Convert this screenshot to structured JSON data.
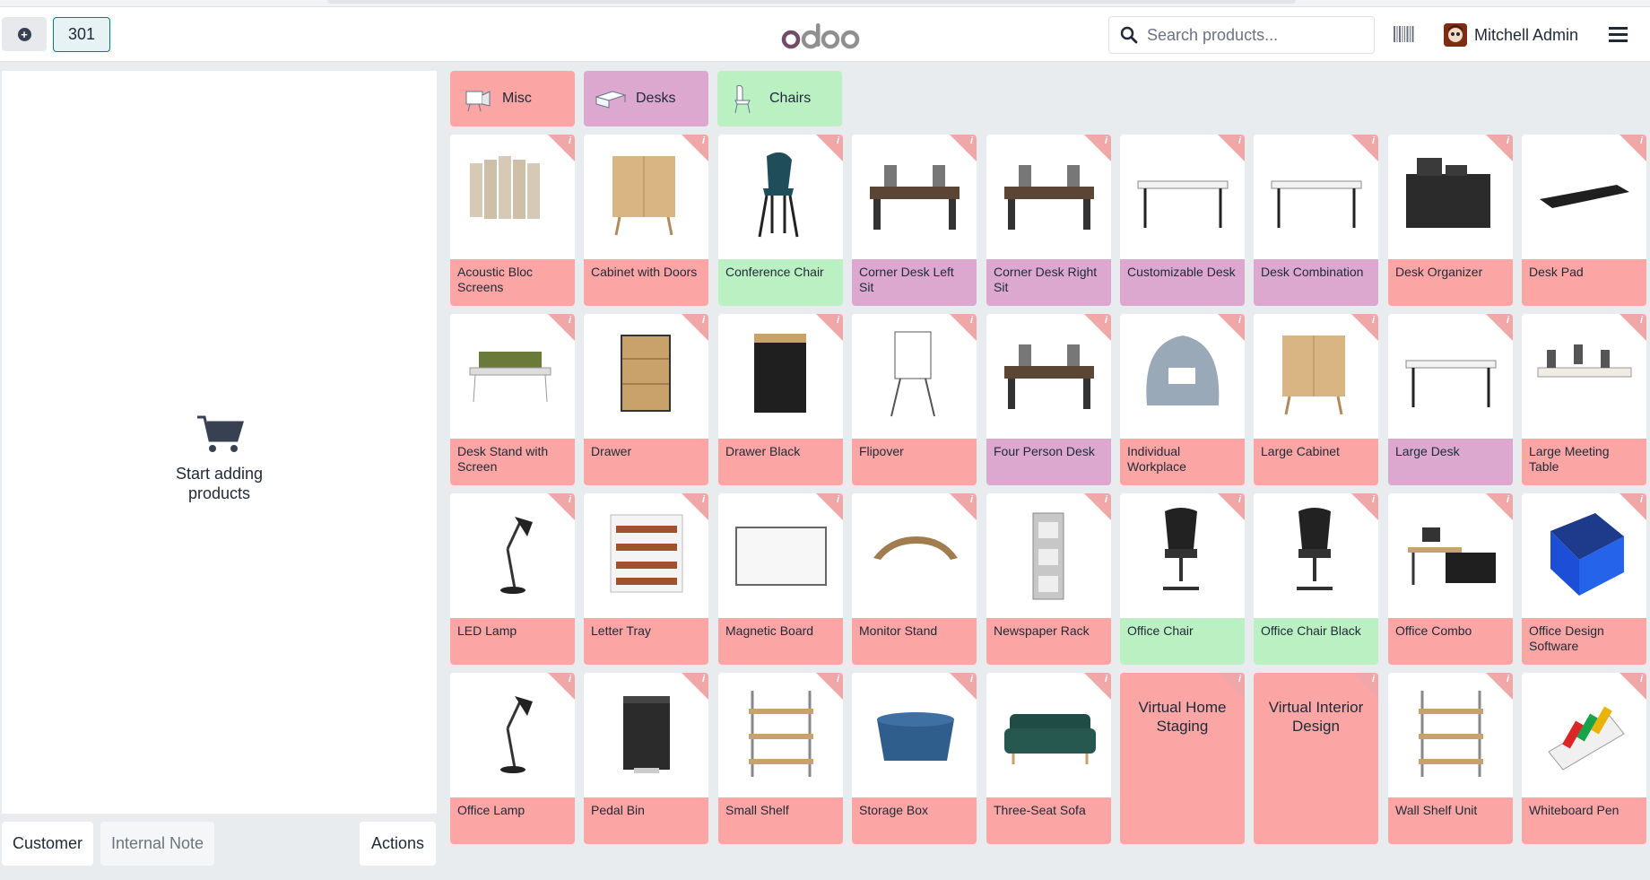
{
  "navbar": {
    "order_number": "301",
    "logo": "odoo",
    "search_placeholder": "Search products...",
    "user_name": "Mitchell Admin"
  },
  "cart": {
    "empty_text": "Start adding products"
  },
  "bottom_buttons": {
    "customer": "Customer",
    "internal_note": "Internal Note",
    "actions": "Actions"
  },
  "colors": {
    "misc": "#fca5a5",
    "desks": "#dca8d0",
    "chairs": "#bbf0c3",
    "accent": "#017e84"
  },
  "categories": [
    {
      "label": "Misc",
      "color": "#fca5a5",
      "icon": "misc-icon"
    },
    {
      "label": "Desks",
      "color": "#dca8d0",
      "icon": "desk-icon"
    },
    {
      "label": "Chairs",
      "color": "#bbf0c3",
      "icon": "chair-icon"
    }
  ],
  "products": [
    {
      "name": "Acoustic Bloc Screens",
      "category": "misc",
      "icon": "screen-icon"
    },
    {
      "name": "Cabinet with Doors",
      "category": "misc",
      "icon": "cabinet-icon"
    },
    {
      "name": "Conference Chair",
      "category": "chairs",
      "icon": "chair-icon"
    },
    {
      "name": "Corner Desk Left Sit",
      "category": "desks",
      "icon": "desk-icon"
    },
    {
      "name": "Corner Desk Right Sit",
      "category": "desks",
      "icon": "desk-icon"
    },
    {
      "name": "Customizable Desk",
      "category": "desks",
      "icon": "table-icon"
    },
    {
      "name": "Desk Combination",
      "category": "desks",
      "icon": "table-icon"
    },
    {
      "name": "Desk Organizer",
      "category": "misc",
      "icon": "organizer-icon"
    },
    {
      "name": "Desk Pad",
      "category": "misc",
      "icon": "pad-icon"
    },
    {
      "name": "Desk Stand with Screen",
      "category": "misc",
      "icon": "stand-icon"
    },
    {
      "name": "Drawer",
      "category": "misc",
      "icon": "drawer-icon"
    },
    {
      "name": "Drawer Black",
      "category": "misc",
      "icon": "drawer-black-icon"
    },
    {
      "name": "Flipover",
      "category": "misc",
      "icon": "flipover-icon"
    },
    {
      "name": "Four Person Desk",
      "category": "desks",
      "icon": "desk-icon"
    },
    {
      "name": "Individual Workplace",
      "category": "misc",
      "icon": "pod-icon"
    },
    {
      "name": "Large Cabinet",
      "category": "misc",
      "icon": "cabinet-icon"
    },
    {
      "name": "Large Desk",
      "category": "desks",
      "icon": "table-icon"
    },
    {
      "name": "Large Meeting Table",
      "category": "misc",
      "icon": "meeting-table-icon"
    },
    {
      "name": "LED Lamp",
      "category": "misc",
      "icon": "lamp-icon"
    },
    {
      "name": "Letter Tray",
      "category": "misc",
      "icon": "tray-icon"
    },
    {
      "name": "Magnetic Board",
      "category": "misc",
      "icon": "board-icon"
    },
    {
      "name": "Monitor Stand",
      "category": "misc",
      "icon": "monitor-stand-icon"
    },
    {
      "name": "Newspaper Rack",
      "category": "misc",
      "icon": "rack-icon"
    },
    {
      "name": "Office Chair",
      "category": "chairs",
      "icon": "office-chair-icon"
    },
    {
      "name": "Office Chair Black",
      "category": "chairs",
      "icon": "office-chair-icon"
    },
    {
      "name": "Office Combo",
      "category": "misc",
      "icon": "combo-icon"
    },
    {
      "name": "Office Design Software",
      "category": "misc",
      "icon": "software-box-icon"
    },
    {
      "name": "Office Lamp",
      "category": "misc",
      "icon": "lamp-icon"
    },
    {
      "name": "Pedal Bin",
      "category": "misc",
      "icon": "bin-icon"
    },
    {
      "name": "Small Shelf",
      "category": "misc",
      "icon": "shelf-icon"
    },
    {
      "name": "Storage Box",
      "category": "misc",
      "icon": "box-icon"
    },
    {
      "name": "Three-Seat Sofa",
      "category": "misc",
      "icon": "sofa-icon"
    },
    {
      "name": "Virtual Home Staging",
      "category": "misc",
      "icon": ""
    },
    {
      "name": "Virtual Interior Design",
      "category": "misc",
      "icon": ""
    },
    {
      "name": "Wall Shelf Unit",
      "category": "misc",
      "icon": "shelf-icon"
    },
    {
      "name": "Whiteboard Pen",
      "category": "misc",
      "icon": "pen-icon"
    }
  ]
}
